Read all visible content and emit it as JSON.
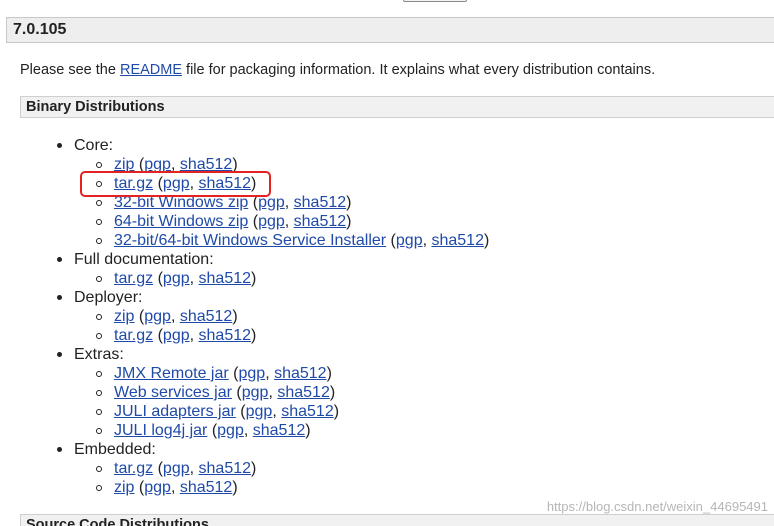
{
  "version_title": "7.0.105",
  "intro": {
    "before": "Please see the ",
    "link": "README",
    "after": " file for packaging information. It explains what every distribution contains."
  },
  "sections": {
    "binary": "Binary Distributions",
    "source": "Source Code Distributions"
  },
  "groups": [
    {
      "label": "Core:",
      "items": [
        {
          "name": "zip",
          "pgp": "pgp",
          "sha": "sha512"
        },
        {
          "name": "tar.gz",
          "pgp": "pgp",
          "sha": "sha512"
        },
        {
          "name": "32-bit Windows zip",
          "pgp": "pgp",
          "sha": "sha512"
        },
        {
          "name": "64-bit Windows zip",
          "pgp": "pgp",
          "sha": "sha512"
        },
        {
          "name": "32-bit/64-bit Windows Service Installer",
          "pgp": "pgp",
          "sha": "sha512"
        }
      ]
    },
    {
      "label": "Full documentation:",
      "items": [
        {
          "name": "tar.gz",
          "pgp": "pgp",
          "sha": "sha512"
        }
      ]
    },
    {
      "label": "Deployer:",
      "items": [
        {
          "name": "zip",
          "pgp": "pgp",
          "sha": "sha512"
        },
        {
          "name": "tar.gz",
          "pgp": "pgp",
          "sha": "sha512"
        }
      ]
    },
    {
      "label": "Extras:",
      "items": [
        {
          "name": "JMX Remote jar",
          "pgp": "pgp",
          "sha": "sha512"
        },
        {
          "name": "Web services jar",
          "pgp": "pgp",
          "sha": "sha512"
        },
        {
          "name": "JULI adapters jar",
          "pgp": "pgp",
          "sha": "sha512"
        },
        {
          "name": "JULI log4j jar",
          "pgp": "pgp",
          "sha": "sha512"
        }
      ]
    },
    {
      "label": "Embedded:",
      "items": [
        {
          "name": "tar.gz",
          "pgp": "pgp",
          "sha": "sha512"
        },
        {
          "name": "zip",
          "pgp": "pgp",
          "sha": "sha512"
        }
      ]
    }
  ],
  "watermark": "https://blog.csdn.net/weixin_44695491",
  "colors": {
    "link": "#1f4aa8",
    "highlight": "#e52222"
  }
}
